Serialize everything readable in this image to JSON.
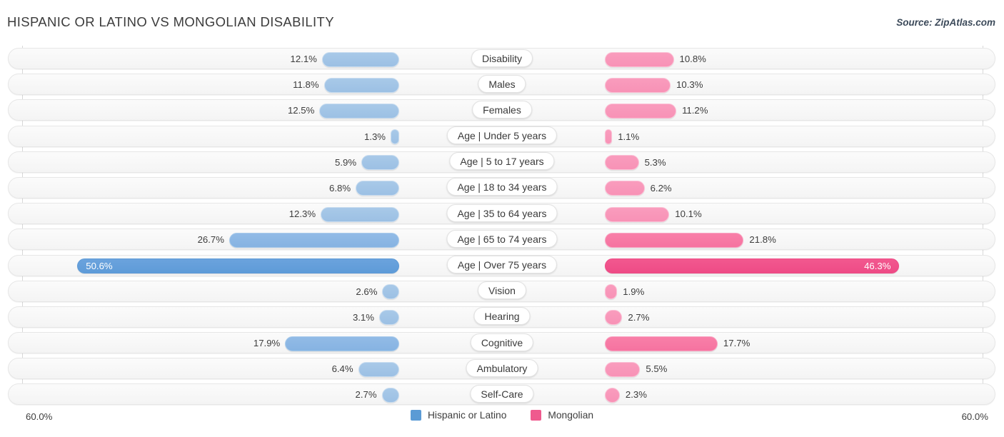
{
  "header": {
    "title": "HISPANIC OR LATINO VS MONGOLIAN DISABILITY",
    "source": "Source: ZipAtlas.com"
  },
  "axis": {
    "left_label": "60.0%",
    "right_label": "60.0%",
    "max": 60.0
  },
  "legend": {
    "items": [
      {
        "label": "Hispanic or Latino",
        "color": "#5b9bd5"
      },
      {
        "label": "Mongolian",
        "color": "#ef5a8e"
      }
    ]
  },
  "chart_data": {
    "type": "bar",
    "title": "HISPANIC OR LATINO VS MONGOLIAN DISABILITY",
    "orientation": "horizontal-diverging",
    "xlabel": "",
    "ylabel": "",
    "xlim": [
      60.0,
      60.0
    ],
    "grid": true,
    "legend_position": "bottom-center",
    "categories": [
      "Disability",
      "Males",
      "Females",
      "Age | Under 5 years",
      "Age | 5 to 17 years",
      "Age | 18 to 34 years",
      "Age | 35 to 64 years",
      "Age | 65 to 74 years",
      "Age | Over 75 years",
      "Vision",
      "Hearing",
      "Cognitive",
      "Ambulatory",
      "Self-Care"
    ],
    "series": [
      {
        "name": "Hispanic or Latino",
        "color": "#5b9bd5",
        "values": [
          12.1,
          11.8,
          12.5,
          1.3,
          5.9,
          6.8,
          12.3,
          26.7,
          50.6,
          2.6,
          3.1,
          17.9,
          6.4,
          2.7
        ]
      },
      {
        "name": "Mongolian",
        "color": "#ef5a8e",
        "values": [
          10.8,
          10.3,
          11.2,
          1.1,
          5.3,
          6.2,
          10.1,
          21.8,
          46.3,
          1.9,
          2.7,
          17.7,
          5.5,
          2.3
        ]
      }
    ]
  },
  "rows": [
    {
      "label": "Disability",
      "left": "12.1%",
      "right": "10.8%"
    },
    {
      "label": "Males",
      "left": "11.8%",
      "right": "10.3%"
    },
    {
      "label": "Females",
      "left": "12.5%",
      "right": "11.2%"
    },
    {
      "label": "Age | Under 5 years",
      "left": "1.3%",
      "right": "1.1%"
    },
    {
      "label": "Age | 5 to 17 years",
      "left": "5.9%",
      "right": "5.3%"
    },
    {
      "label": "Age | 18 to 34 years",
      "left": "6.8%",
      "right": "6.2%"
    },
    {
      "label": "Age | 35 to 64 years",
      "left": "12.3%",
      "right": "10.1%"
    },
    {
      "label": "Age | 65 to 74 years",
      "left": "26.7%",
      "right": "21.8%"
    },
    {
      "label": "Age | Over 75 years",
      "left": "50.6%",
      "right": "46.3%"
    },
    {
      "label": "Vision",
      "left": "2.6%",
      "right": "1.9%"
    },
    {
      "label": "Hearing",
      "left": "3.1%",
      "right": "2.7%"
    },
    {
      "label": "Cognitive",
      "left": "17.9%",
      "right": "17.7%"
    },
    {
      "label": "Ambulatory",
      "left": "6.4%",
      "right": "5.5%"
    },
    {
      "label": "Self-Care",
      "left": "2.7%",
      "right": "2.3%"
    }
  ]
}
